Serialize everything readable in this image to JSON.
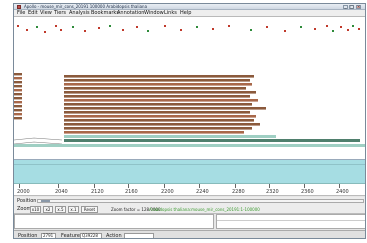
{
  "window": {
    "title": "Apollo - mouse_mir_cons_20191 100000 Arabidopsis thaliana"
  },
  "menu": [
    {
      "label": "File"
    },
    {
      "label": "Edit"
    },
    {
      "label": "View"
    },
    {
      "label": "Tiers"
    },
    {
      "label": "Analysis"
    },
    {
      "label": "Bookmarks"
    },
    {
      "label": "Annotation"
    },
    {
      "label": "Window"
    },
    {
      "label": "Links"
    },
    {
      "label": "Help"
    }
  ],
  "colors": {
    "feature": "#8b5a3c",
    "feature_alt": "#a8684a",
    "annotation": "#4f7f6d",
    "annotation_light": "#9fcfc3",
    "sequence": "#a6dde3",
    "track_name": "#3a9a2e"
  },
  "ruler": {
    "ticks": [
      "2000",
      "2040",
      "2120",
      "2160",
      "2200",
      "2240",
      "2280",
      "2320",
      "2360",
      "2400"
    ]
  },
  "position_row": {
    "label": "Position"
  },
  "zoom": {
    "label": "Zoom",
    "buttons": [
      "x10",
      "x2",
      "x.5",
      "x.1",
      "Reset"
    ],
    "factor_text": "Zoom factor = 128.0000",
    "track_name": "Arabidopsis thaliana:mouse_mir_cons_20191:1-100000"
  },
  "status": {
    "position_label": "Position",
    "position_value": "2791",
    "feature_label": "Feature",
    "feature_value": "Q39228",
    "action_label": "Action",
    "action_value": ""
  }
}
